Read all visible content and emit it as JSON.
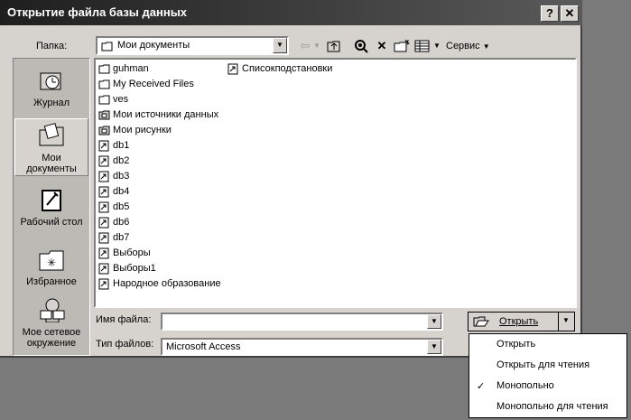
{
  "dialog": {
    "title": "Открытие файла базы данных",
    "help_button": "?",
    "close_button": "✕"
  },
  "toolbar": {
    "folder_label": "Папка:",
    "folder_value": "Мои документы",
    "tools_label": "Сервис"
  },
  "places": [
    {
      "label": "Журнал",
      "icon": "history-icon"
    },
    {
      "label": "Мои документы",
      "icon": "my-documents-icon"
    },
    {
      "label": "Рабочий стол",
      "icon": "desktop-icon"
    },
    {
      "label": "Избранное",
      "icon": "favorites-icon"
    },
    {
      "label": "Мое сетевое окружение",
      "icon": "network-icon"
    }
  ],
  "files": [
    {
      "name": "guhman",
      "type": "folder"
    },
    {
      "name": "My Received Files",
      "type": "folder"
    },
    {
      "name": "ves",
      "type": "folder"
    },
    {
      "name": "Мои источники данных",
      "type": "folder-special"
    },
    {
      "name": "Мои рисунки",
      "type": "folder-special"
    },
    {
      "name": "db1",
      "type": "shortcut"
    },
    {
      "name": "db2",
      "type": "shortcut"
    },
    {
      "name": "db3",
      "type": "shortcut"
    },
    {
      "name": "db4",
      "type": "shortcut"
    },
    {
      "name": "db5",
      "type": "shortcut"
    },
    {
      "name": "db6",
      "type": "shortcut"
    },
    {
      "name": "db7",
      "type": "shortcut"
    },
    {
      "name": "Выборы",
      "type": "shortcut"
    },
    {
      "name": "Выборы1",
      "type": "shortcut"
    },
    {
      "name": "Народное образование",
      "type": "shortcut"
    },
    {
      "name": "Списокподстановки",
      "type": "shortcut"
    }
  ],
  "filename": {
    "label": "Имя файла:",
    "value": ""
  },
  "filetype": {
    "label": "Тип файлов:",
    "value": "Microsoft Access"
  },
  "open_button": {
    "label": "Открыть"
  },
  "open_menu": [
    {
      "label": "Открыть",
      "checked": false
    },
    {
      "label": "Открыть для чтения",
      "checked": false
    },
    {
      "label": "Монопольно",
      "checked": true
    },
    {
      "label": "Монопольно для чтения",
      "checked": false
    }
  ],
  "checkmark": "✓"
}
